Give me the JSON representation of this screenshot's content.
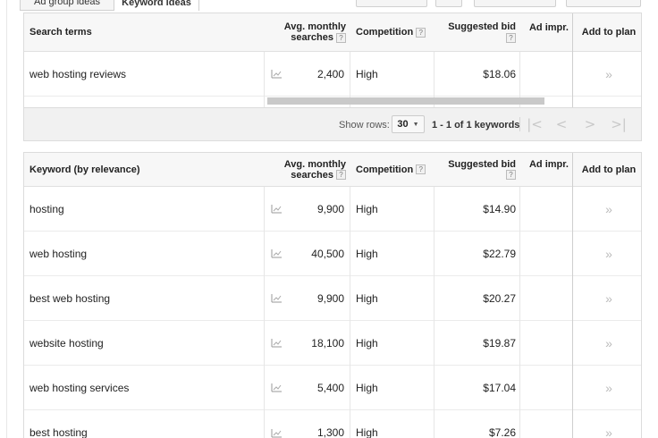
{
  "tabs": [
    {
      "label": "Ad group ideas"
    },
    {
      "label": "Keyword ideas"
    }
  ],
  "search_table": {
    "headers": {
      "term": "Search terms",
      "avg_line1": "Avg. monthly",
      "avg_line2": "searches",
      "competition": "Competition",
      "bid": "Suggested bid",
      "ad_impr": "Ad impr.",
      "add_to_plan": "Add to plan",
      "help": "?"
    },
    "rows": [
      {
        "term": "web hosting reviews",
        "searches": "2,400",
        "competition": "High",
        "bid": "$18.06",
        "add": "»"
      }
    ]
  },
  "pager": {
    "show_rows_label": "Show rows:",
    "rows_value": "30",
    "caret": "▼",
    "range_text": "1 - 1 of 1 keywords",
    "first": "|<",
    "prev": "<",
    "next": ">",
    "last": ">|"
  },
  "keyword_table": {
    "headers": {
      "term": "Keyword (by relevance)",
      "avg_line1": "Avg. monthly",
      "avg_line2": "searches",
      "competition": "Competition",
      "bid": "Suggested bid",
      "ad_impr": "Ad impr.",
      "add_to_plan": "Add to plan",
      "help": "?"
    },
    "rows": [
      {
        "term": "hosting",
        "searches": "9,900",
        "competition": "High",
        "bid": "$14.90",
        "add": "»"
      },
      {
        "term": "web hosting",
        "searches": "40,500",
        "competition": "High",
        "bid": "$22.79",
        "add": "»"
      },
      {
        "term": "best web hosting",
        "searches": "9,900",
        "competition": "High",
        "bid": "$20.27",
        "add": "»"
      },
      {
        "term": "website hosting",
        "searches": "18,100",
        "competition": "High",
        "bid": "$19.87",
        "add": "»"
      },
      {
        "term": "web hosting services",
        "searches": "5,400",
        "competition": "High",
        "bid": "$17.04",
        "add": "»"
      },
      {
        "term": "best hosting",
        "searches": "1,300",
        "competition": "High",
        "bid": "$7.26",
        "add": "»"
      }
    ]
  },
  "icons": {
    "trend": "trend-chart-icon"
  }
}
